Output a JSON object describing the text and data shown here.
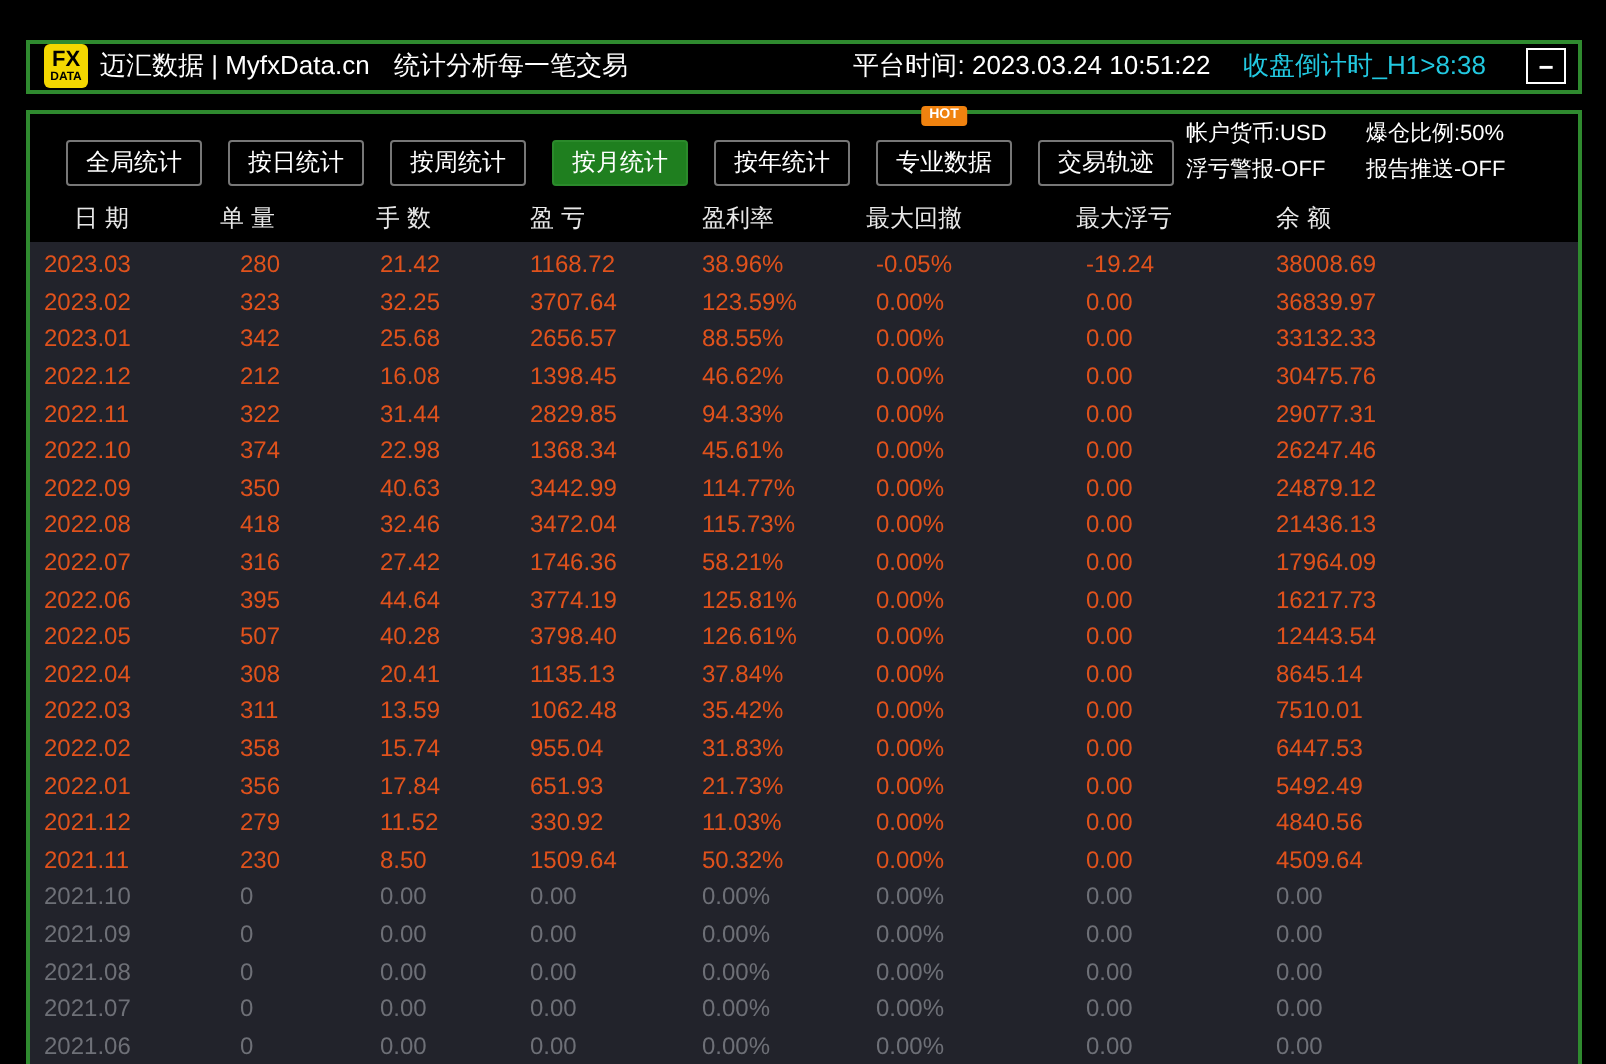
{
  "header": {
    "logo": {
      "top": "FX",
      "bottom": "DATA"
    },
    "title": "迈汇数据 | MyfxData.cn",
    "slogan": "统计分析每一笔交易",
    "platform_time": "平台时间: 2023.03.24 10:51:22",
    "countdown": "收盘倒计时_H1>8:38",
    "minimize": "−"
  },
  "tabs": [
    {
      "label": "全局统计",
      "selected": false
    },
    {
      "label": "按日统计",
      "selected": false
    },
    {
      "label": "按周统计",
      "selected": false
    },
    {
      "label": "按月统计",
      "selected": true
    },
    {
      "label": "按年统计",
      "selected": false
    },
    {
      "label": "专业数据",
      "selected": false,
      "badge": "HOT"
    },
    {
      "label": "交易轨迹",
      "selected": false
    }
  ],
  "info": [
    "帐户货币:USD",
    "爆仓比例:50%",
    "浮亏警报-OFF",
    "报告推送-OFF"
  ],
  "table": {
    "columns": [
      "日 期",
      "单 量",
      "手 数",
      "盈 亏",
      "盈利率",
      "最大回撤",
      "最大浮亏",
      "余 额"
    ],
    "rows": [
      {
        "muted": false,
        "cells": [
          "2023.03",
          "280",
          "21.42",
          "1168.72",
          "38.96%",
          "-0.05%",
          "-19.24",
          "38008.69"
        ]
      },
      {
        "muted": false,
        "cells": [
          "2023.02",
          "323",
          "32.25",
          "3707.64",
          "123.59%",
          "0.00%",
          "0.00",
          "36839.97"
        ]
      },
      {
        "muted": false,
        "cells": [
          "2023.01",
          "342",
          "25.68",
          "2656.57",
          "88.55%",
          "0.00%",
          "0.00",
          "33132.33"
        ]
      },
      {
        "muted": false,
        "cells": [
          "2022.12",
          "212",
          "16.08",
          "1398.45",
          "46.62%",
          "0.00%",
          "0.00",
          "30475.76"
        ]
      },
      {
        "muted": false,
        "cells": [
          "2022.11",
          "322",
          "31.44",
          "2829.85",
          "94.33%",
          "0.00%",
          "0.00",
          "29077.31"
        ]
      },
      {
        "muted": false,
        "cells": [
          "2022.10",
          "374",
          "22.98",
          "1368.34",
          "45.61%",
          "0.00%",
          "0.00",
          "26247.46"
        ]
      },
      {
        "muted": false,
        "cells": [
          "2022.09",
          "350",
          "40.63",
          "3442.99",
          "114.77%",
          "0.00%",
          "0.00",
          "24879.12"
        ]
      },
      {
        "muted": false,
        "cells": [
          "2022.08",
          "418",
          "32.46",
          "3472.04",
          "115.73%",
          "0.00%",
          "0.00",
          "21436.13"
        ]
      },
      {
        "muted": false,
        "cells": [
          "2022.07",
          "316",
          "27.42",
          "1746.36",
          "58.21%",
          "0.00%",
          "0.00",
          "17964.09"
        ]
      },
      {
        "muted": false,
        "cells": [
          "2022.06",
          "395",
          "44.64",
          "3774.19",
          "125.81%",
          "0.00%",
          "0.00",
          "16217.73"
        ]
      },
      {
        "muted": false,
        "cells": [
          "2022.05",
          "507",
          "40.28",
          "3798.40",
          "126.61%",
          "0.00%",
          "0.00",
          "12443.54"
        ]
      },
      {
        "muted": false,
        "cells": [
          "2022.04",
          "308",
          "20.41",
          "1135.13",
          "37.84%",
          "0.00%",
          "0.00",
          "8645.14"
        ]
      },
      {
        "muted": false,
        "cells": [
          "2022.03",
          "311",
          "13.59",
          "1062.48",
          "35.42%",
          "0.00%",
          "0.00",
          "7510.01"
        ]
      },
      {
        "muted": false,
        "cells": [
          "2022.02",
          "358",
          "15.74",
          "955.04",
          "31.83%",
          "0.00%",
          "0.00",
          "6447.53"
        ]
      },
      {
        "muted": false,
        "cells": [
          "2022.01",
          "356",
          "17.84",
          "651.93",
          "21.73%",
          "0.00%",
          "0.00",
          "5492.49"
        ]
      },
      {
        "muted": false,
        "cells": [
          "2021.12",
          "279",
          "11.52",
          "330.92",
          "11.03%",
          "0.00%",
          "0.00",
          "4840.56"
        ]
      },
      {
        "muted": false,
        "cells": [
          "2021.11",
          "230",
          "8.50",
          "1509.64",
          "50.32%",
          "0.00%",
          "0.00",
          "4509.64"
        ]
      },
      {
        "muted": true,
        "cells": [
          "2021.10",
          "0",
          "0.00",
          "0.00",
          "0.00%",
          "0.00%",
          "0.00",
          "0.00"
        ]
      },
      {
        "muted": true,
        "cells": [
          "2021.09",
          "0",
          "0.00",
          "0.00",
          "0.00%",
          "0.00%",
          "0.00",
          "0.00"
        ]
      },
      {
        "muted": true,
        "cells": [
          "2021.08",
          "0",
          "0.00",
          "0.00",
          "0.00%",
          "0.00%",
          "0.00",
          "0.00"
        ]
      },
      {
        "muted": true,
        "cells": [
          "2021.07",
          "0",
          "0.00",
          "0.00",
          "0.00%",
          "0.00%",
          "0.00",
          "0.00"
        ]
      },
      {
        "muted": true,
        "cells": [
          "2021.06",
          "0",
          "0.00",
          "0.00",
          "0.00%",
          "0.00%",
          "0.00",
          "0.00"
        ]
      }
    ]
  }
}
